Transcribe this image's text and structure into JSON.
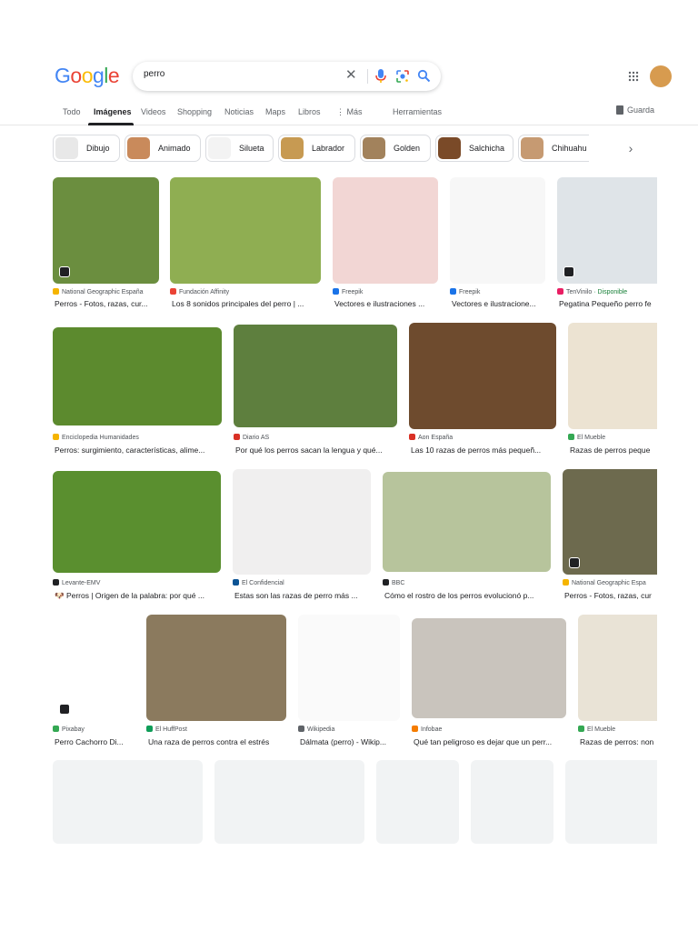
{
  "search": {
    "query": "perro"
  },
  "tabs": [
    {
      "label": "Todo"
    },
    {
      "label": "Imágenes"
    },
    {
      "label": "Videos"
    },
    {
      "label": "Shopping"
    },
    {
      "label": "Noticias"
    },
    {
      "label": "Maps"
    },
    {
      "label": "Libros"
    },
    {
      "label": "⋮ Más"
    },
    {
      "label": "Herramientas"
    }
  ],
  "save_label": "Guarda",
  "chips": [
    {
      "label": "Dibujo",
      "color": "#e8e8e8"
    },
    {
      "label": "Animado",
      "color": "#c98a5b"
    },
    {
      "label": "Silueta",
      "color": "#f3f3f3"
    },
    {
      "label": "Labrador",
      "color": "#c79a52"
    },
    {
      "label": "Golden",
      "color": "#a2825c"
    },
    {
      "label": "Salchicha",
      "color": "#7a4a28"
    },
    {
      "label": "Chihuahu",
      "color": "#c69a72"
    }
  ],
  "results": [
    {
      "source": "National Geographic España",
      "title": "Perros - Fotos, razas, cur...",
      "fav": "#f5b400",
      "color": "#6b8e3f"
    },
    {
      "source": "Fundación Affinity",
      "title": "Los 8 sonidos principales del perro | ...",
      "fav": "#ea4335",
      "color": "#8fae52"
    },
    {
      "source": "Freepik",
      "title": "Vectores e ilustraciones ...",
      "fav": "#1a73e8",
      "color": "#f2d6d4"
    },
    {
      "source": "Freepik",
      "title": "Vectores e ilustracione...",
      "fav": "#1a73e8",
      "color": "#f7f7f7"
    },
    {
      "source": "TenVinilo",
      "source_extra": " · Disponible",
      "title": "Pegatina Pequeño perro fe",
      "fav": "#e91e63",
      "color": "#dfe4e8"
    },
    {
      "source": "Enciclopedia Humanidades",
      "title": "Perros: surgimiento, características, alime...",
      "fav": "#f5b400",
      "color": "#5c8a2e"
    },
    {
      "source": "Diario AS",
      "title": "Por qué los perros sacan la lengua y qué...",
      "fav": "#d93025",
      "color": "#5e7f3e"
    },
    {
      "source": "Aon España",
      "title": "Las 10 razas de perros más pequeñ...",
      "fav": "#d93025",
      "color": "#6e4b2e"
    },
    {
      "source": "El Mueble",
      "title": "Razas de perros peque",
      "fav": "#34a853",
      "color": "#ece3d2"
    },
    {
      "source": "Levante-EMV",
      "title": "🐶 Perros | Origen de la palabra: por qué ...",
      "fav": "#202124",
      "color": "#5a8f2f"
    },
    {
      "source": "El Confidencial",
      "title": "Estas son las razas de perro más ...",
      "fav": "#0b5394",
      "color": "#f0efef"
    },
    {
      "source": "BBC",
      "title": "Cómo el rostro de los perros evolucionó p...",
      "fav": "#202124",
      "color": "#b7c49c"
    },
    {
      "source": "National Geographic Espa",
      "title": "Perros - Fotos, razas, cur",
      "fav": "#f5b400",
      "color": "#6d6a4e"
    },
    {
      "source": "Pixabay",
      "title": "Perro Cachorro Di...",
      "fav": "#34a853",
      "color": "#ffffff"
    },
    {
      "source": "El HuffPost",
      "title": "Una raza de perros contra el estrés",
      "fav": "#0f9d58",
      "color": "#8b7a5e"
    },
    {
      "source": "Wikipedia",
      "title": "Dálmata (perro) - Wikip...",
      "fav": "#5f6368",
      "color": "#fafafa"
    },
    {
      "source": "Infobae",
      "title": "Qué tan peligroso es dejar que un perr...",
      "fav": "#f57c00",
      "color": "#c9c4bd"
    },
    {
      "source": "El Mueble",
      "title": "Razas de perros: non",
      "fav": "#34a853",
      "color": "#e9e3d6"
    }
  ]
}
